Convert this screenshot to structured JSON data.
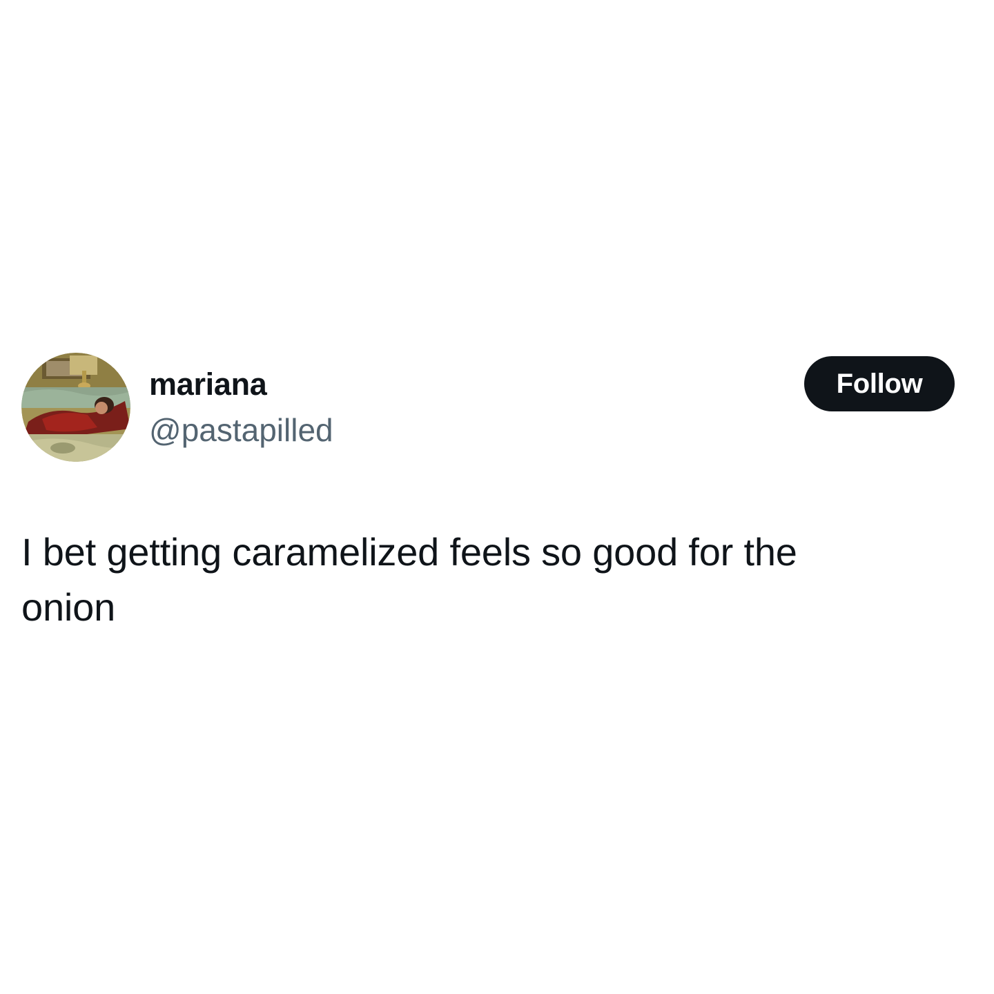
{
  "author": {
    "display_name": "mariana",
    "handle": "@pastapilled",
    "avatar_icon": "profile-photo-avatar"
  },
  "actions": {
    "follow_label": "Follow"
  },
  "tweet": {
    "text_lines": [
      "I bet getting caramelized feels so good for the",
      "onion"
    ]
  },
  "colors": {
    "text_primary": "#0f1419",
    "text_secondary": "#536471",
    "button_bg": "#0f1419",
    "button_text": "#ffffff",
    "background": "#ffffff"
  }
}
